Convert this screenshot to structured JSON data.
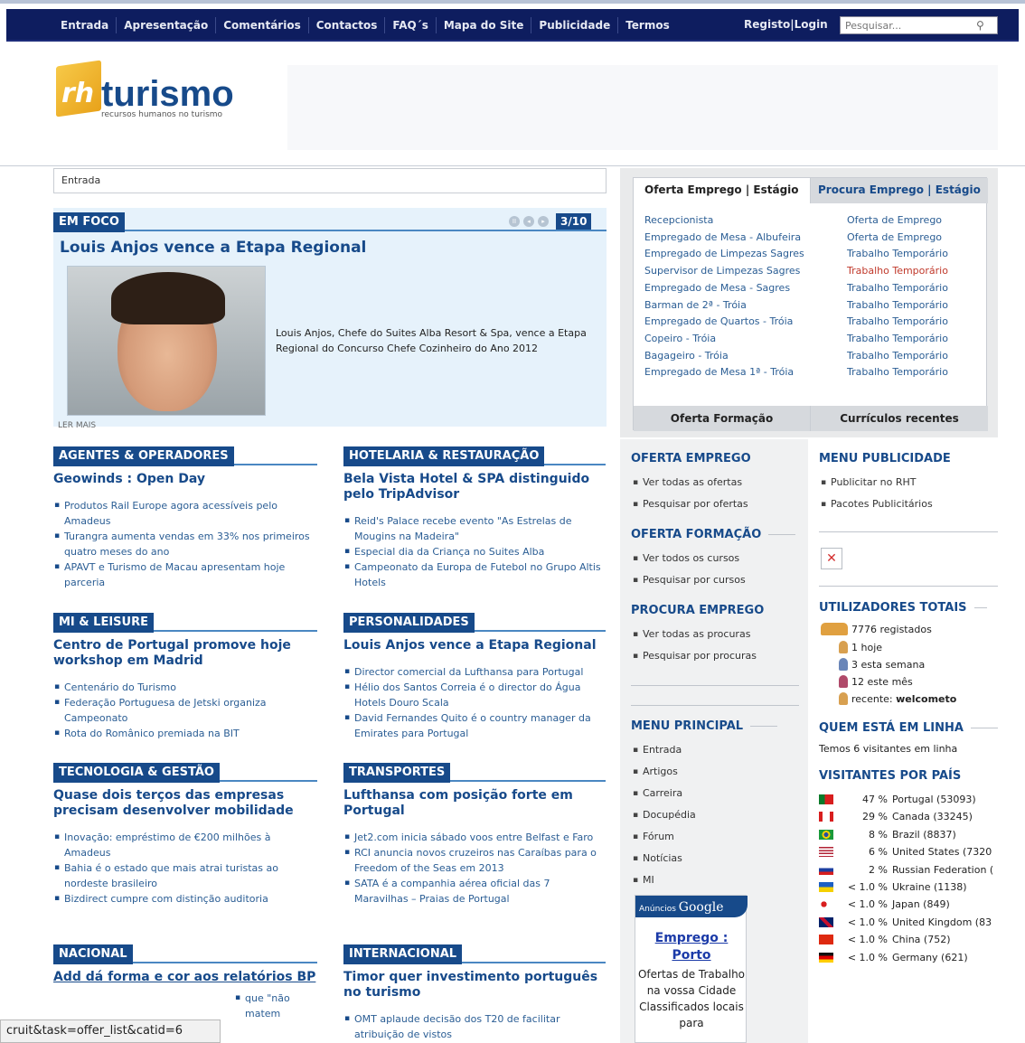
{
  "nav": {
    "items": [
      "Entrada",
      "Apresentação",
      "Comentários",
      "Contactos",
      "FAQ´s",
      "Mapa do Site",
      "Publicidade",
      "Termos"
    ],
    "login": "Registo|Login",
    "search_placeholder": "Pesquisar..."
  },
  "logo": {
    "rh": "rh",
    "name": "turismo",
    "tagline": "recursos humanos no turismo"
  },
  "breadcrumb": "Entrada",
  "focus": {
    "label": "EM FOCO",
    "counter": "3/10",
    "title": "Louis Anjos vence a Etapa Regional",
    "text": "Louis Anjos, Chefe do Suites Alba Resort & Spa, vence a Etapa Regional do Concurso Chefe Cozinheiro do Ano 2012",
    "more": "LER MAIS"
  },
  "sections": [
    {
      "label": "AGENTES & OPERADORES",
      "title": "Geowinds : Open Day",
      "items": [
        "Produtos Rail Europe agora acessíveis pelo Amadeus",
        "Turangra aumenta vendas em 33% nos primeiros quatro meses do ano",
        "APAVT e Turismo de Macau apresentam hoje parceria"
      ]
    },
    {
      "label": "HOTELARIA & RESTAURAÇÃO",
      "title": "Bela Vista Hotel & SPA distinguido pelo TripAdvisor",
      "items": [
        "Reid's Palace recebe evento \"As Estrelas de Mougins na Madeira\"",
        "Especial dia da Criança no Suites Alba",
        "Campeonato da Europa de Futebol no Grupo Altis Hotels"
      ]
    },
    {
      "label": "MI & LEISURE",
      "title": "Centro de Portugal promove hoje workshop em Madrid",
      "items": [
        "Centenário do Turismo",
        "Federação Portuguesa de Jetski organiza Campeonato",
        "Rota do Românico premiada na BIT"
      ]
    },
    {
      "label": "PERSONALIDADES",
      "title": "Louis Anjos vence a Etapa Regional",
      "items": [
        "Director comercial da Lufthansa para Portugal",
        "Hélio dos Santos Correia é o director do Água Hotels Douro Scala",
        "David Fernandes Quito é o country manager da Emirates para Portugal"
      ]
    },
    {
      "label": "TECNOLOGIA & GESTÃO",
      "title": "Quase dois terços das empresas precisam desenvolver mobilidade",
      "items": [
        "Inovação: empréstimo de €200 milhões à Amadeus",
        "Bahia é o estado que mais atrai turistas ao nordeste brasileiro",
        "Bizdirect cumpre com distinção auditoria"
      ]
    },
    {
      "label": "TRANSPORTES",
      "title": "Lufthansa com posição forte em Portugal",
      "items": [
        "Jet2.com inicia sábado voos entre Belfast e Faro",
        "RCI anuncia novos cruzeiros nas Caraíbas para o Freedom of the Seas em 2013",
        "SATA é a companhia aérea oficial das 7 Maravilhas – Praias de Portugal"
      ]
    },
    {
      "label": "NACIONAL",
      "title": "Add dá forma e cor aos relatórios BP",
      "items": [
        "que \"não matem"
      ]
    },
    {
      "label": "INTERNACIONAL",
      "title": "Timor quer investimento português no turismo",
      "items": [
        "OMT aplaude decisão dos T20 de facilitar atribuição de vistos"
      ]
    }
  ],
  "jobs": {
    "tab_a": "Oferta Emprego | Estágio",
    "tab_b": "Procura Emprego | Estágio",
    "tab_c": "Oferta Formação",
    "tab_d": "Currículos recentes",
    "list": [
      {
        "title": "Recepcionista",
        "type": "Oferta de Emprego"
      },
      {
        "title": "Empregado de Mesa - Albufeira",
        "type": "Oferta de Emprego"
      },
      {
        "title": "Empregado de Limpezas Sagres",
        "type": "Trabalho Temporário"
      },
      {
        "title": "Supervisor de Limpezas Sagres",
        "type": "Trabalho Temporário"
      },
      {
        "title": "Empregado de Mesa - Sagres",
        "type": "Trabalho Temporário"
      },
      {
        "title": "Barman de 2ª - Tróia",
        "type": "Trabalho Temporário"
      },
      {
        "title": "Empregado de Quartos - Tróia",
        "type": "Trabalho Temporário"
      },
      {
        "title": "Copeiro - Tróia",
        "type": "Trabalho Temporário"
      },
      {
        "title": "Bagageiro - Tróia",
        "type": "Trabalho Temporário"
      },
      {
        "title": "Empregado de Mesa 1ª - Tróia",
        "type": "Trabalho Temporário"
      }
    ]
  },
  "menus": {
    "oferta_emprego": {
      "title": "OFERTA EMPREGO",
      "items": [
        "Ver todas as ofertas",
        "Pesquisar por ofertas"
      ]
    },
    "oferta_formacao": {
      "title": "OFERTA FORMAÇÃO",
      "items": [
        "Ver todos os cursos",
        "Pesquisar por cursos"
      ]
    },
    "procura_emprego": {
      "title": "PROCURA EMPREGO",
      "items": [
        "Ver todas as procuras",
        "Pesquisar por procuras"
      ]
    },
    "menu_principal": {
      "title": "MENU PRINCIPAL",
      "items": [
        "Entrada",
        "Artigos",
        "Carreira",
        "Docupédia",
        "Fórum",
        "Notícias",
        "MI"
      ]
    },
    "menu_publicidade": {
      "title": "MENU PUBLICIDADE",
      "items": [
        "Publicitar no RHT",
        "Pacotes Publicitários"
      ]
    }
  },
  "ad": {
    "label": "Anúncios",
    "brand": "Google",
    "link": "Emprego : Porto",
    "text": "Ofertas de Trabalho na vossa Cidade Classificados locais para"
  },
  "users": {
    "title": "UTILIZADORES TOTAIS",
    "registered": "7776 registados",
    "today": "1 hoje",
    "week": "3 esta semana",
    "month": "12 este mês",
    "recent_label": "recente:",
    "recent_user": "welcometo"
  },
  "online": {
    "title": "QUEM ESTÁ EM LINHA",
    "text": "Temos 6 visitantes em linha"
  },
  "visitors": {
    "title": "VISITANTES POR PAÍS",
    "rows": [
      {
        "pct": "47 %",
        "name": "Portugal (53093)",
        "flag": "pt"
      },
      {
        "pct": "29 %",
        "name": "Canada (33245)",
        "flag": "ca"
      },
      {
        "pct": "8 %",
        "name": "Brazil (8837)",
        "flag": "br"
      },
      {
        "pct": "6 %",
        "name": "United States (7320",
        "flag": "us"
      },
      {
        "pct": "2 %",
        "name": "Russian Federation (",
        "flag": "ru"
      },
      {
        "pct": "< 1.0 %",
        "name": "Ukraine (1138)",
        "flag": "ua"
      },
      {
        "pct": "< 1.0 %",
        "name": "Japan (849)",
        "flag": "jp"
      },
      {
        "pct": "< 1.0 %",
        "name": "United Kingdom (83",
        "flag": "gb"
      },
      {
        "pct": "< 1.0 %",
        "name": "China (752)",
        "flag": "cn"
      },
      {
        "pct": "< 1.0 %",
        "name": "Germany (621)",
        "flag": "de"
      }
    ]
  },
  "statusbar": "cruit&task=offer_list&catid=6",
  "colors": {
    "nav": "#0e1d5f",
    "accent": "#174a8a",
    "link": "#2a5d94"
  }
}
